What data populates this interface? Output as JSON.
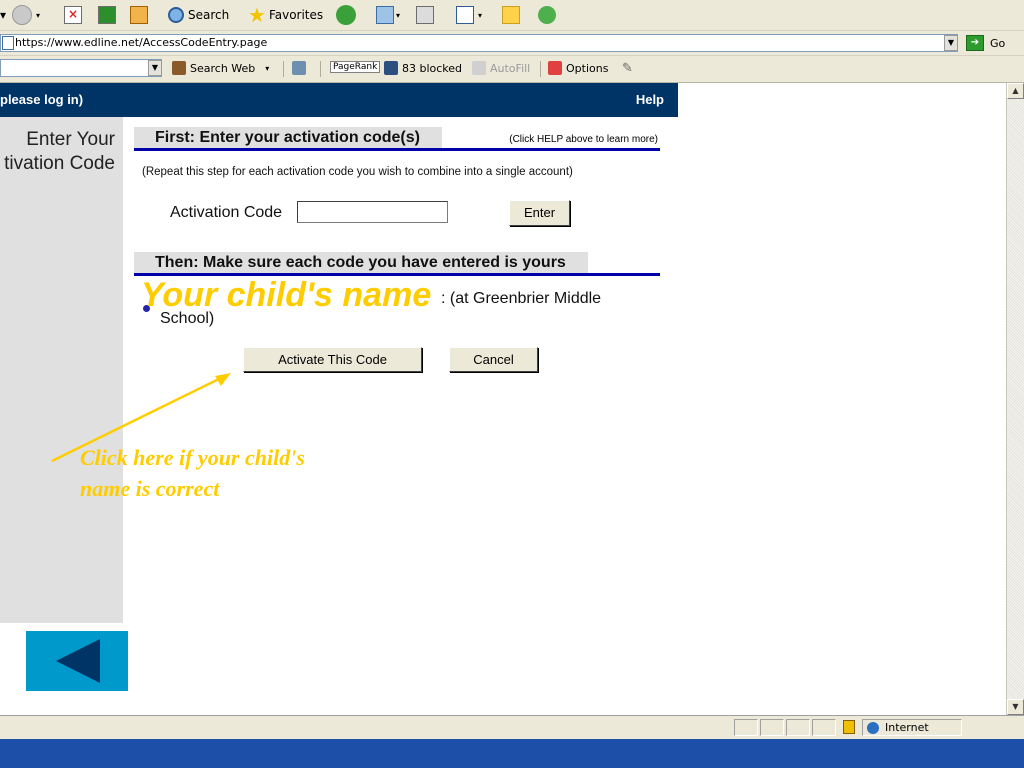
{
  "browser": {
    "toolbar": {
      "search_label": "Search",
      "favorites_label": "Favorites"
    },
    "address": {
      "url": "https://www.edline.net/AccessCodeEntry.page",
      "go_label": "Go"
    },
    "links_bar": {
      "search_web_label": "Search Web",
      "pagerank_label": "PageRank",
      "blocked_label": "83 blocked",
      "autofill_label": "AutoFill",
      "options_label": "Options"
    },
    "status": {
      "zone_label": "Internet"
    }
  },
  "page": {
    "top_bar": {
      "left_text": "please log in)",
      "help_label": "Help"
    },
    "side_panel": {
      "line1": "Enter Your",
      "line2": "tivation Code"
    },
    "step1": {
      "heading": "First: Enter your activation code(s)",
      "help_note": "(Click HELP above to learn more)",
      "repeat_note": "(Repeat this step for each activation code you wish to combine into a single account)",
      "code_label": "Activation Code",
      "code_value": "",
      "enter_label": "Enter"
    },
    "step2": {
      "heading": "Then: Make sure each code you have entered is yours",
      "child_name": "Your child's name",
      "school_line1": ": (at Greenbrier Middle",
      "school_line2": "School)",
      "activate_label": "Activate This Code",
      "cancel_label": "Cancel"
    },
    "annotation": {
      "line1": "Click here if your child's",
      "line2": "name is correct"
    }
  },
  "colors": {
    "header_bg": "#003366",
    "annotation": "#ffcc00",
    "section_rule": "#0000aa",
    "back_button": "#0099cc"
  }
}
